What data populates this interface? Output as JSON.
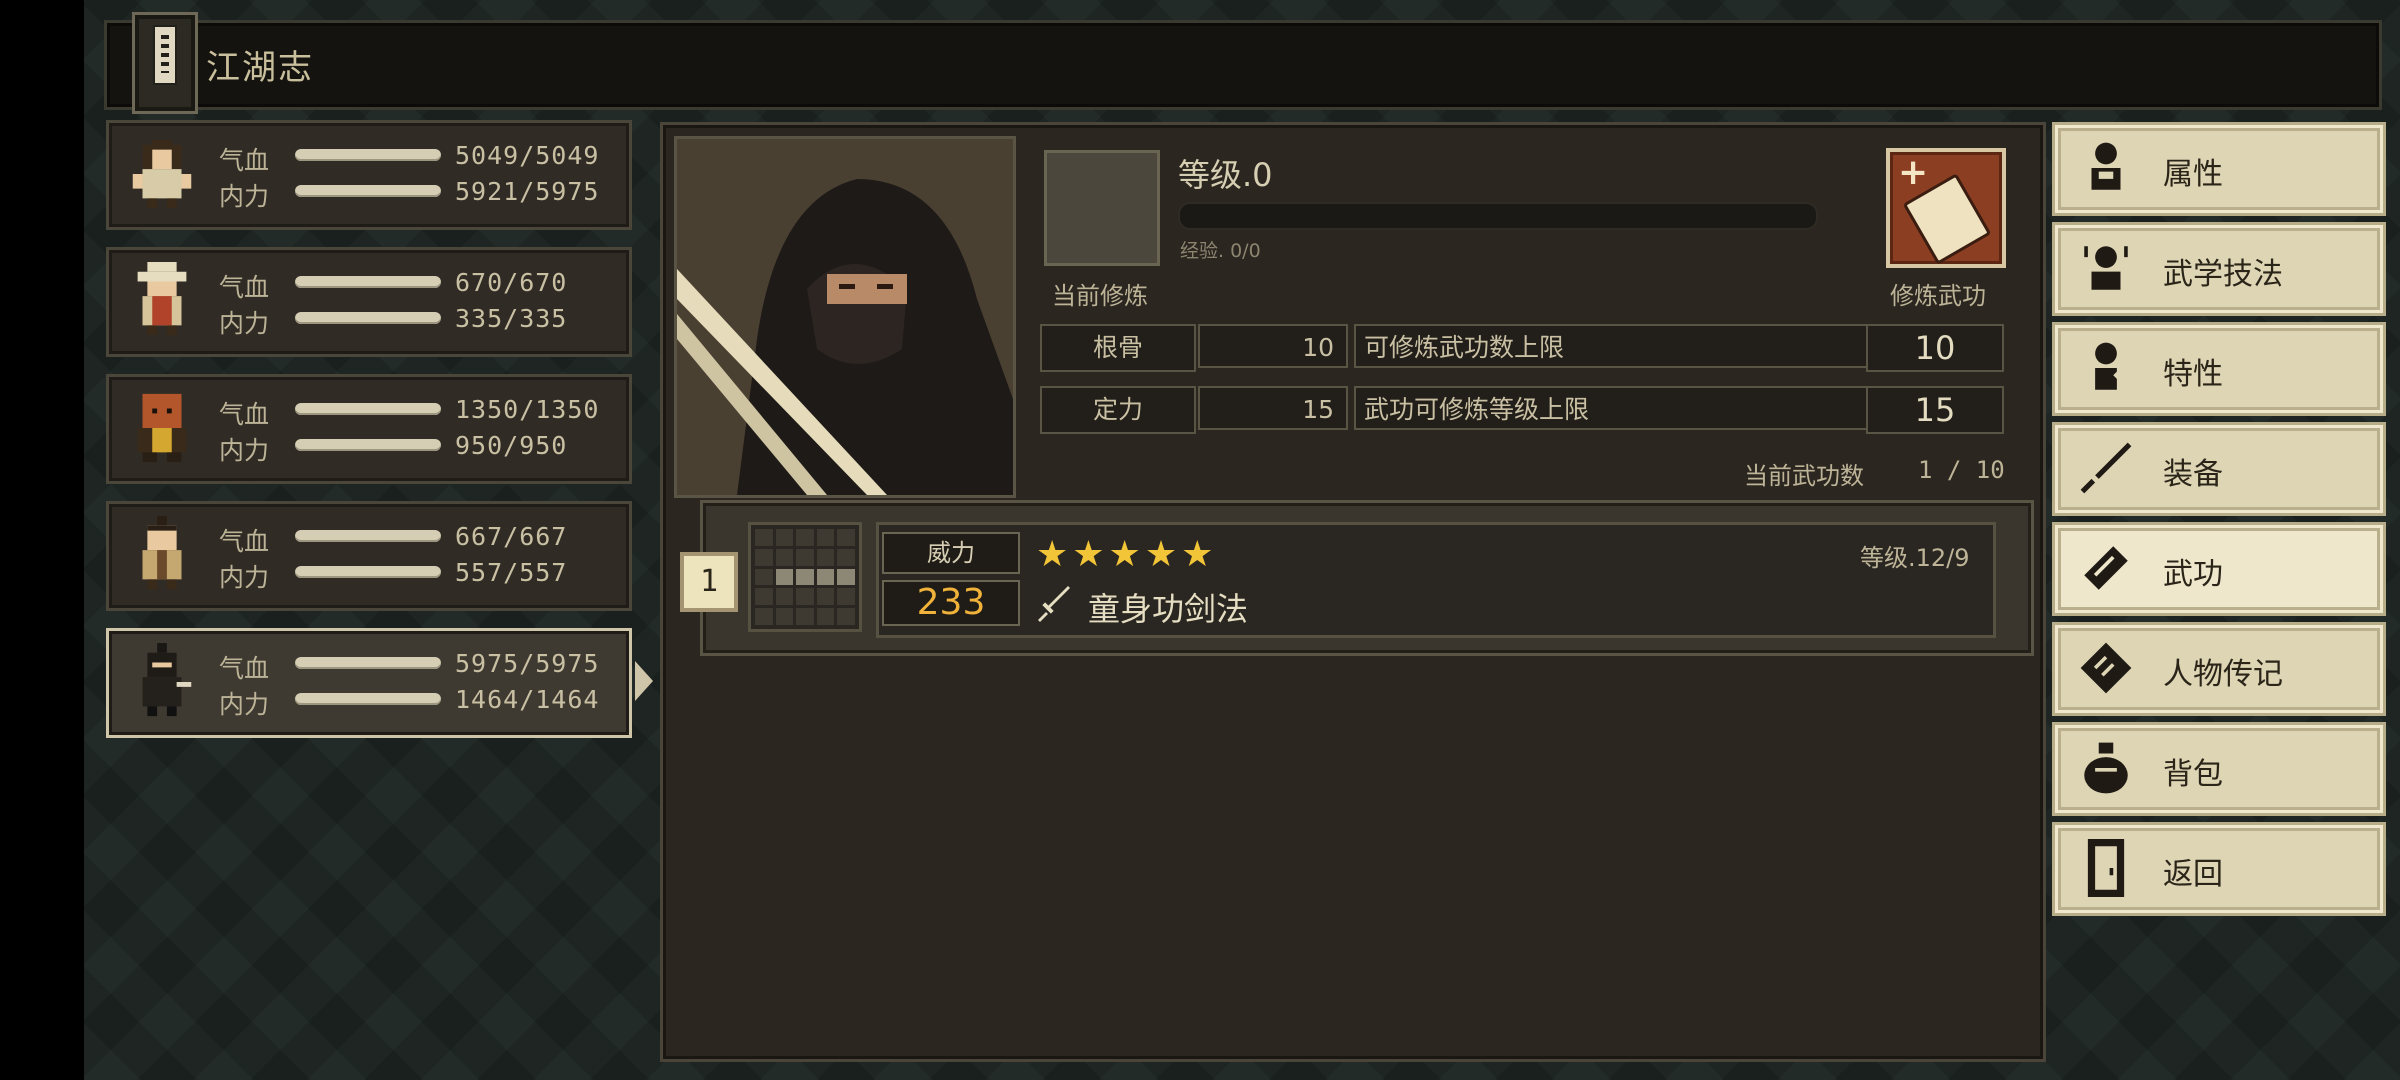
{
  "title": "江湖志",
  "characters": [
    {
      "hp_label": "气血",
      "hp": "5049/5049",
      "mp_label": "内力",
      "mp": "5921/5975",
      "selected": false
    },
    {
      "hp_label": "气血",
      "hp": "670/670",
      "mp_label": "内力",
      "mp": "335/335",
      "selected": false
    },
    {
      "hp_label": "气血",
      "hp": "1350/1350",
      "mp_label": "内力",
      "mp": "950/950",
      "selected": false
    },
    {
      "hp_label": "气血",
      "hp": "667/667",
      "mp_label": "内力",
      "mp": "557/557",
      "selected": false
    },
    {
      "hp_label": "气血",
      "hp": "5975/5975",
      "mp_label": "内力",
      "mp": "1464/1464",
      "selected": true
    }
  ],
  "training": {
    "level": "等级.0",
    "exp": "经验. 0/0",
    "current_label": "当前修炼",
    "train_label": "修炼武功"
  },
  "attributes": [
    {
      "name": "根骨",
      "value": "10",
      "desc": "可修炼武功数上限",
      "limit": "10"
    },
    {
      "name": "定力",
      "value": "15",
      "desc": "武功可修炼等级上限",
      "limit": "15"
    }
  ],
  "skill_count_label": "当前武功数",
  "skill_count": "1 / 10",
  "skills": [
    {
      "index": "1",
      "power_label": "威力",
      "power": "233",
      "stars": "★★★★★",
      "name": "童身功剑法",
      "level": "等级.12/9"
    }
  ],
  "menu": [
    {
      "label": "属性",
      "icon": "person-attributes-icon"
    },
    {
      "label": "武学技法",
      "icon": "martial-technique-icon"
    },
    {
      "label": "特性",
      "icon": "traits-icon"
    },
    {
      "label": "装备",
      "icon": "sword-equipment-icon"
    },
    {
      "label": "武功",
      "icon": "book-martial-icon",
      "active": true
    },
    {
      "label": "人物传记",
      "icon": "biography-scroll-icon"
    },
    {
      "label": "背包",
      "icon": "bag-icon"
    },
    {
      "label": "返回",
      "icon": "door-return-icon"
    }
  ],
  "colors": {
    "accent": "#f2c437",
    "power": "#f0b23a",
    "train_button": "#8b3e22"
  }
}
